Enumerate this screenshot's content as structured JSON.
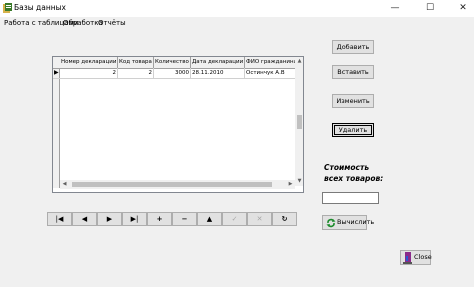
{
  "window": {
    "title": "Базы данных",
    "minimize": "—",
    "maximize": "☐",
    "close": "✕"
  },
  "menu": [
    "Работа с таблицами",
    "Обработка",
    "Отчёты"
  ],
  "grid": {
    "columns": [
      "Номер декларации",
      "Код товара",
      "Количество",
      "Дата декларации",
      "ФИО гражданина"
    ],
    "rows": [
      {
        "indicator": "▶",
        "cells": [
          "2",
          "2",
          "3000",
          "28.11.2010",
          "Остинчук А.В"
        ]
      }
    ]
  },
  "buttons": {
    "add": "Добавить",
    "insert": "Вставить",
    "edit": "Изменить",
    "delete": "Удалить",
    "calculate": "Вычислить",
    "close": "Close"
  },
  "cost": {
    "label_line1": "Стоимость",
    "label_line2": "всех товаров:",
    "value": ""
  },
  "navigator": {
    "first": "|◀",
    "prior": "◀",
    "next": "▶",
    "last": "▶|",
    "insert": "+",
    "delete": "−",
    "edit": "▲",
    "post": "✓",
    "cancel": "✕",
    "refresh": "↻"
  }
}
